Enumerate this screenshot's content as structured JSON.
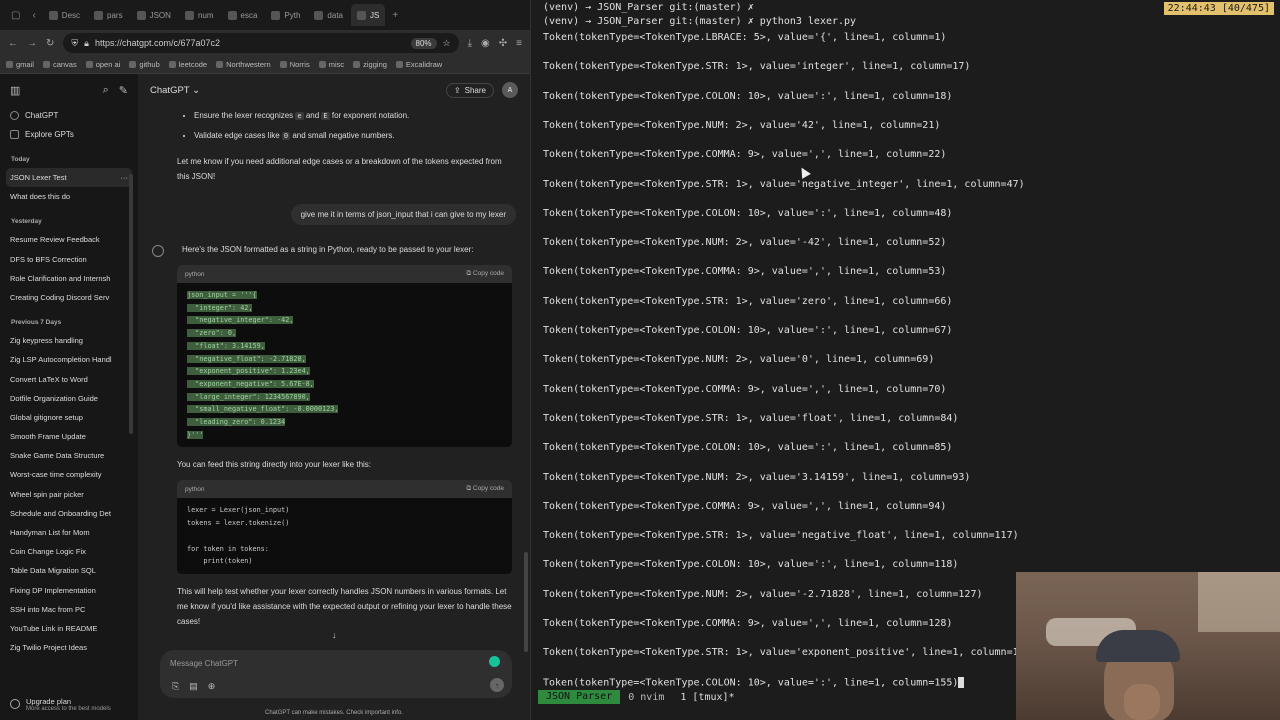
{
  "browser": {
    "tabs": [
      "Desc",
      "pars",
      "JSON",
      "num",
      "esca",
      "Pyth",
      "data",
      "JS"
    ],
    "url": "https://chatgpt.com/c/677a07c2",
    "zoom": "80%",
    "bookmarks": [
      "gmail",
      "canvas",
      "open ai",
      "github",
      "leetcode",
      "Northwestern",
      "Norris",
      "misc",
      "zigging",
      "Excalidraw"
    ]
  },
  "sidebar": {
    "top_links": [
      "ChatGPT",
      "Explore GPTs"
    ],
    "groups": [
      {
        "label": "Today",
        "items": [
          "JSON Lexer Test",
          "What does this do"
        ]
      },
      {
        "label": "Yesterday",
        "items": [
          "Resume Review Feedback",
          "DFS to BFS Correction",
          "Role Clarification and Internsh",
          "Creating Coding Discord Serv"
        ]
      },
      {
        "label": "Previous 7 Days",
        "items": [
          "Zig keypress handling",
          "Zig LSP Autocompletion Handl",
          "Convert LaTeX to Word",
          "Dotfile Organization Guide",
          "Global gitignore setup",
          "Smooth Frame Update",
          "Snake Game Data Structure",
          "Worst-case time complexity",
          "Wheel spin pair picker",
          "Schedule and Onboarding Det",
          "Handyman List for Mom",
          "Coin Change Logic Fix",
          "Table Data Migration SQL",
          "Fixing DP Implementation",
          "SSH into Mac from PC",
          "YouTube Link in README",
          "Zig Twilio Project Ideas"
        ]
      }
    ],
    "upgrade_title": "Upgrade plan",
    "upgrade_sub": "More access to the best models"
  },
  "chat": {
    "model": "ChatGPT",
    "share_label": "Share",
    "avatar_letter": "A",
    "bullet1_a": "Ensure the lexer recognizes ",
    "bullet1_code1": "e",
    "bullet1_b": " and ",
    "bullet1_code2": "E",
    "bullet1_c": " for exponent notation.",
    "bullet2_a": "Validate edge cases like ",
    "bullet2_code": "0",
    "bullet2_b": " and small negative numbers.",
    "para1": "Let me know if you need additional edge cases or a breakdown of the tokens expected from this JSON!",
    "user_msg": "give me it in terms of json_input that i can give to my lexer",
    "reply_intro": "Here's the JSON formatted as a string in Python, ready to be passed to your lexer:",
    "code1_lang": "python",
    "copy_label": "Copy code",
    "code1_lines": [
      "json_input = '''{",
      "  \"integer\": 42,",
      "  \"negative_integer\": -42,",
      "  \"zero\": 0,",
      "  \"float\": 3.14159,",
      "  \"negative_float\": -2.71828,",
      "  \"exponent_positive\": 1.23e4,",
      "  \"exponent_negative\": 5.67E-8,",
      "  \"large_integer\": 1234567890,",
      "  \"small_negative_float\": -0.0000123,",
      "  \"leading_zero\": 0.1234",
      "}'''"
    ],
    "para2": "You can feed this string directly into your lexer like this:",
    "code2_lang": "python",
    "code2_lines": [
      "lexer = Lexer(json_input)",
      "tokens = lexer.tokenize()",
      "",
      "for token in tokens:",
      "    print(token)"
    ],
    "para3": "This will help test whether your lexer correctly handles JSON numbers in various formats. Let me know if you'd like assistance with the expected output or refining your lexer to handle these cases!",
    "composer_placeholder": "Message ChatGPT",
    "disclaimer": "ChatGPT can make mistakes. Check important info."
  },
  "terminal": {
    "clock": "22:44:43 [40/475]",
    "lines": [
      "(venv) → JSON_Parser git:(master) ✗",
      "(venv) → JSON_Parser git:(master) ✗ python3 lexer.py",
      "Token(tokenType=<TokenType.LBRACE: 5>, value='{', line=1, column=1)",
      "Token(tokenType=<TokenType.STR: 1>, value='integer', line=1, column=17)",
      "Token(tokenType=<TokenType.COLON: 10>, value=':', line=1, column=18)",
      "Token(tokenType=<TokenType.NUM: 2>, value='42', line=1, column=21)",
      "Token(tokenType=<TokenType.COMMA: 9>, value=',', line=1, column=22)",
      "Token(tokenType=<TokenType.STR: 1>, value='negative_integer', line=1, column=47)",
      "Token(tokenType=<TokenType.COLON: 10>, value=':', line=1, column=48)",
      "Token(tokenType=<TokenType.NUM: 2>, value='-42', line=1, column=52)",
      "Token(tokenType=<TokenType.COMMA: 9>, value=',', line=1, column=53)",
      "Token(tokenType=<TokenType.STR: 1>, value='zero', line=1, column=66)",
      "Token(tokenType=<TokenType.COLON: 10>, value=':', line=1, column=67)",
      "Token(tokenType=<TokenType.NUM: 2>, value='0', line=1, column=69)",
      "Token(tokenType=<TokenType.COMMA: 9>, value=',', line=1, column=70)",
      "Token(tokenType=<TokenType.STR: 1>, value='float', line=1, column=84)",
      "Token(tokenType=<TokenType.COLON: 10>, value=':', line=1, column=85)",
      "Token(tokenType=<TokenType.NUM: 2>, value='3.14159', line=1, column=93)",
      "Token(tokenType=<TokenType.COMMA: 9>, value=',', line=1, column=94)",
      "Token(tokenType=<TokenType.STR: 1>, value='negative_float', line=1, column=117)",
      "Token(tokenType=<TokenType.COLON: 10>, value=':', line=1, column=118)",
      "Token(tokenType=<TokenType.NUM: 2>, value='-2.71828', line=1, column=127)",
      "Token(tokenType=<TokenType.COMMA: 9>, value=',', line=1, column=128)",
      "Token(tokenType=<TokenType.STR: 1>, value='exponent_positive', line=1, column=1",
      "Token(tokenType=<TokenType.COLON: 10>, value=':', line=1, column=155)"
    ],
    "status_session": "JSON Parser",
    "status_win0": "0 nvim",
    "status_win1": "1 [tmux]*"
  },
  "colors": {
    "tmux_session": "#2e8b3e",
    "clock_bg": "#e3c06b"
  }
}
